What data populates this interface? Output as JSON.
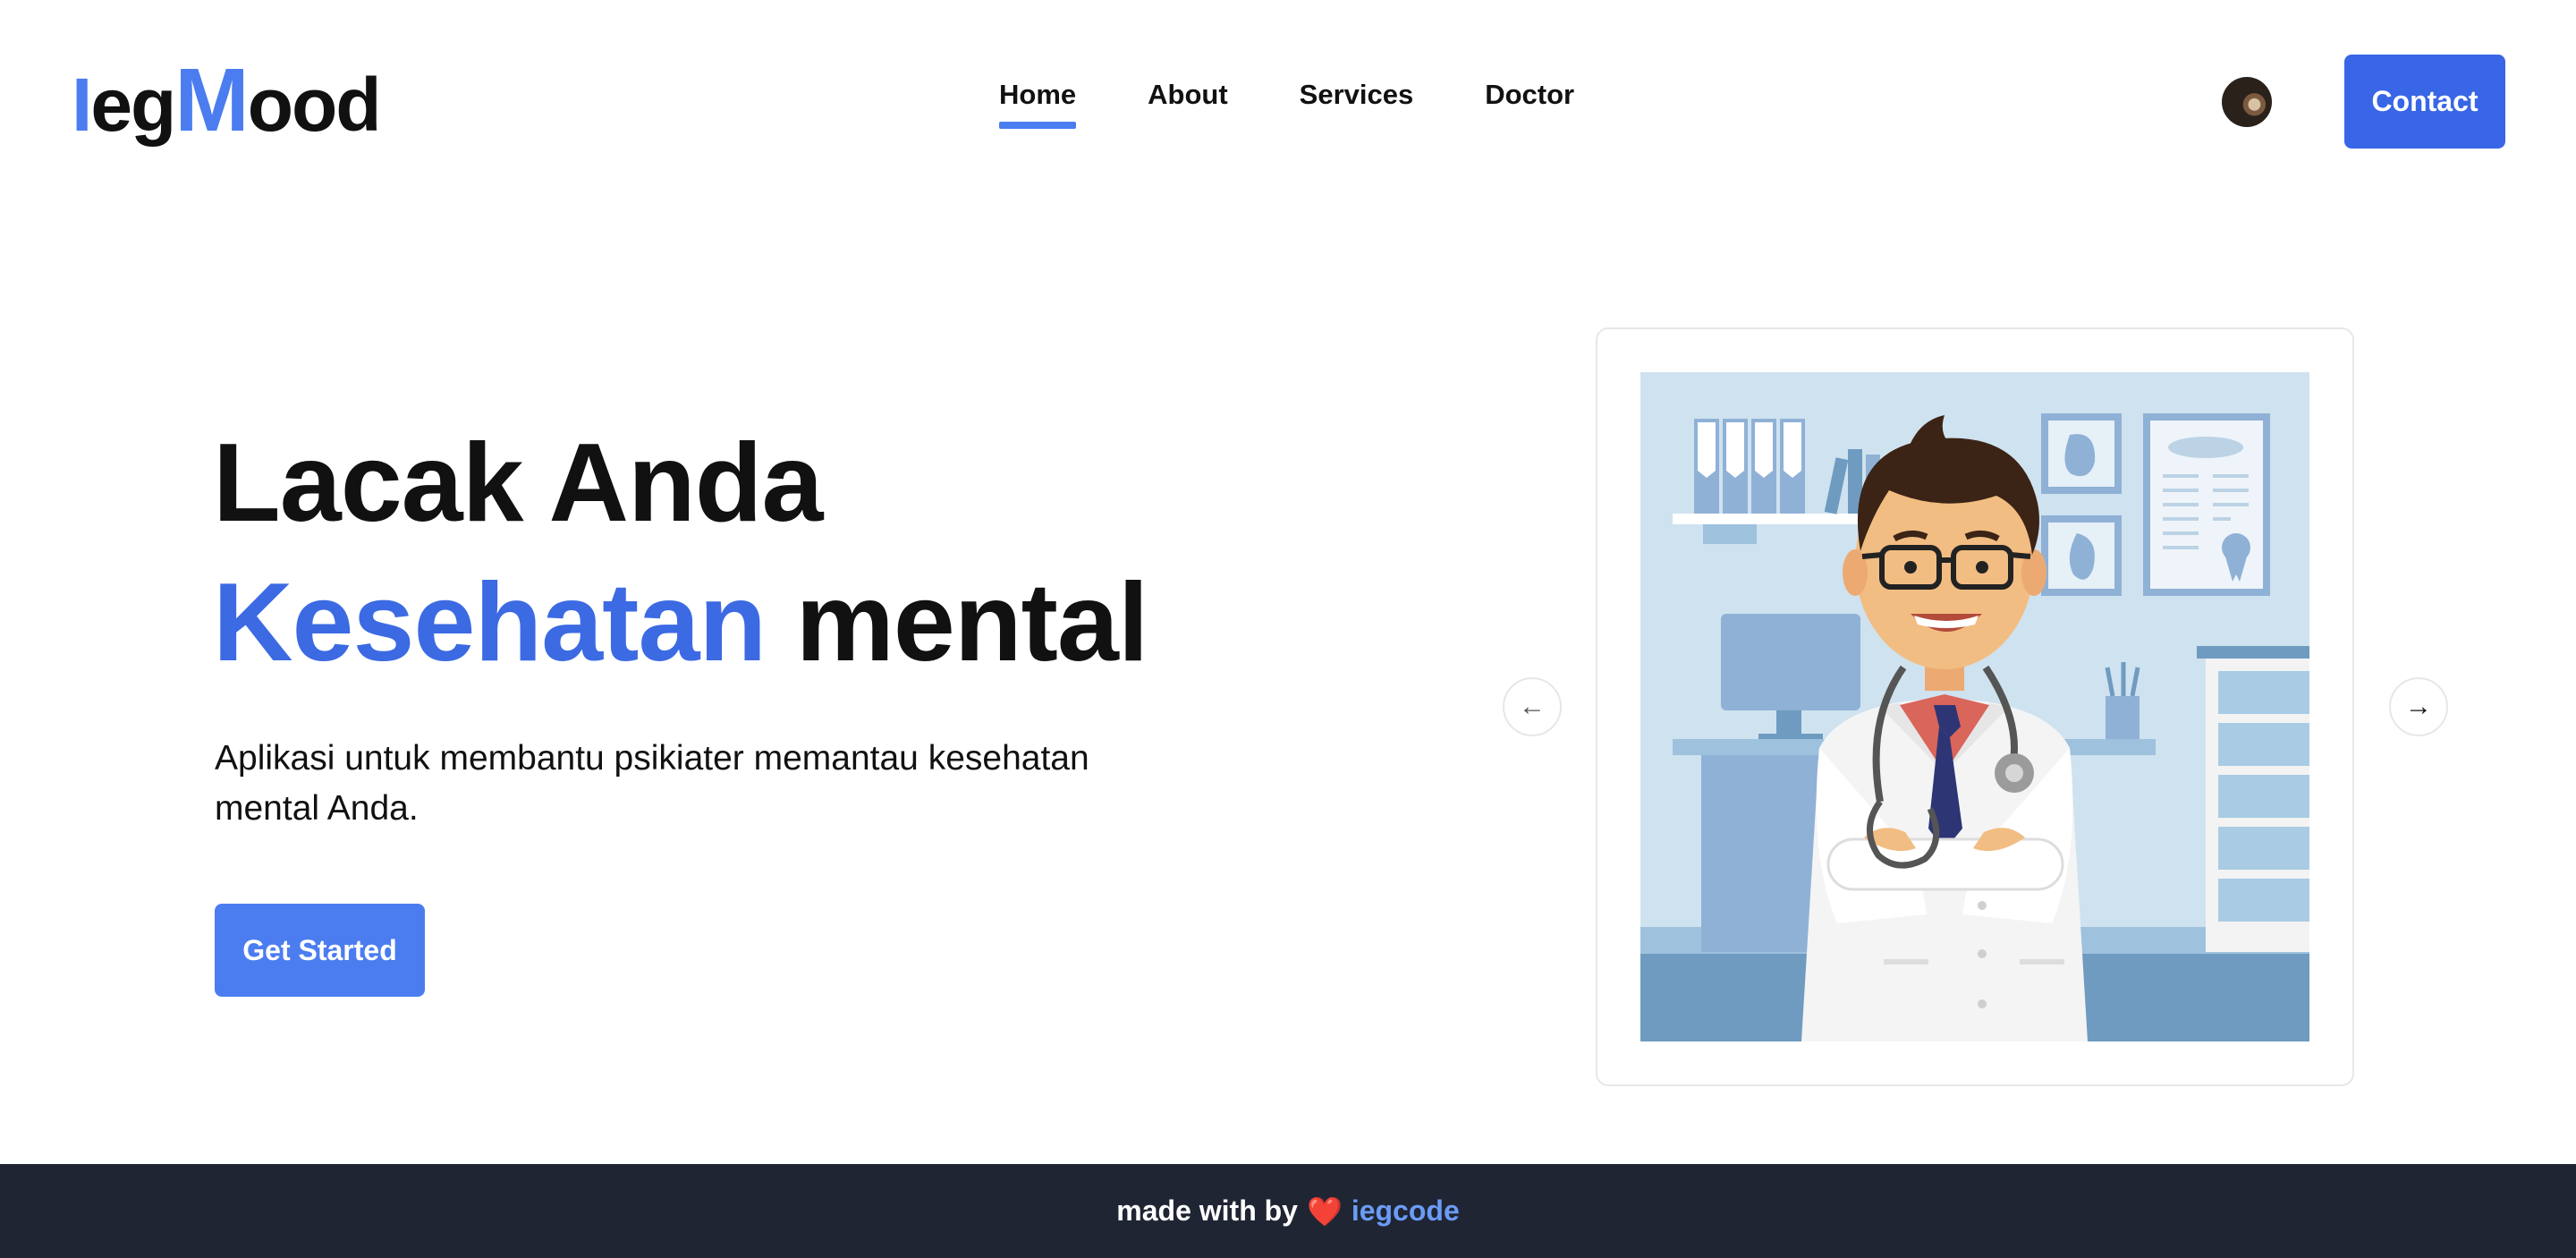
{
  "brand": {
    "logo_prefix": "I",
    "logo_eg": "eg",
    "logo_m": "M",
    "logo_suffix": "ood",
    "accent_color": "#4b7df0"
  },
  "nav": {
    "items": [
      {
        "label": "Home",
        "active": true
      },
      {
        "label": "About",
        "active": false
      },
      {
        "label": "Services",
        "active": false
      },
      {
        "label": "Doctor",
        "active": false
      }
    ],
    "contact_label": "Contact"
  },
  "hero": {
    "title_line1": "Lacak Anda",
    "title_accent": "Kesehatan",
    "title_rest": "mental",
    "description": "Aplikasi untuk membantu psikiater memantau kesehatan mental Anda.",
    "cta_label": "Get Started"
  },
  "carousel": {
    "prev_icon": "arrow-left-icon",
    "next_icon": "arrow-right-icon",
    "prev_glyph": "←",
    "next_glyph": "→"
  },
  "footer": {
    "text": "made with by",
    "heart": "❤️",
    "author": "iegcode"
  }
}
